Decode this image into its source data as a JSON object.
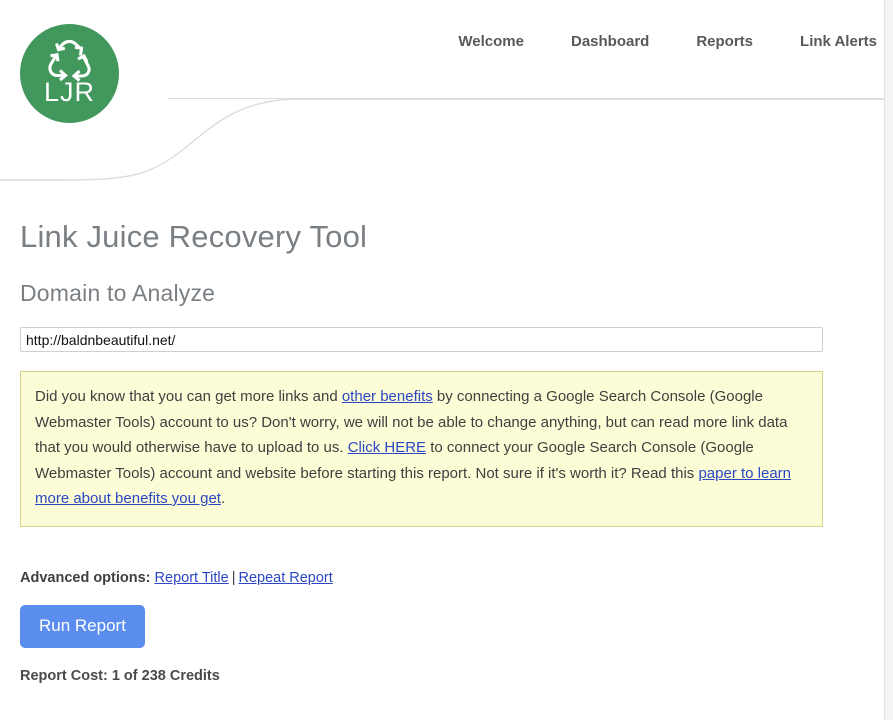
{
  "brand": {
    "logo_text": "LJR",
    "logo_icon": "recycle-icon",
    "logo_color": "#41975c"
  },
  "nav": {
    "items": [
      {
        "label": "Welcome"
      },
      {
        "label": "Dashboard"
      },
      {
        "label": "Reports"
      },
      {
        "label": "Link Alerts"
      }
    ]
  },
  "main": {
    "page_title": "Link Juice Recovery Tool",
    "section_title": "Domain to Analyze",
    "domain_input": {
      "value": "http://baldnbeautiful.net/",
      "placeholder": "http://"
    },
    "notice": {
      "part1": "Did you know that you can get more links and ",
      "link1": "other benefits",
      "part2": " by connecting a Google Search Console (Google Webmaster Tools) account to us? Don't worry, we will not be able to change anything, but can read more link data that you would otherwise have to upload to us. ",
      "link2": "Click HERE",
      "part3": " to connect your Google Search Console (Google Webmaster Tools) account and website before starting this report. Not sure if it's worth it? Read this ",
      "link3": "paper to learn more about benefits you get",
      "part4": ".",
      "background_color": "#fcfcd7",
      "border_color": "#d3d38b"
    },
    "advanced": {
      "label": "Advanced options:",
      "link_report_title": "Report Title",
      "separator": "|",
      "link_repeat_report": "Repeat Report"
    },
    "run_button": {
      "label": "Run Report",
      "color": "#5b8def"
    },
    "report_cost": "Report Cost: 1 of 238 Credits"
  }
}
